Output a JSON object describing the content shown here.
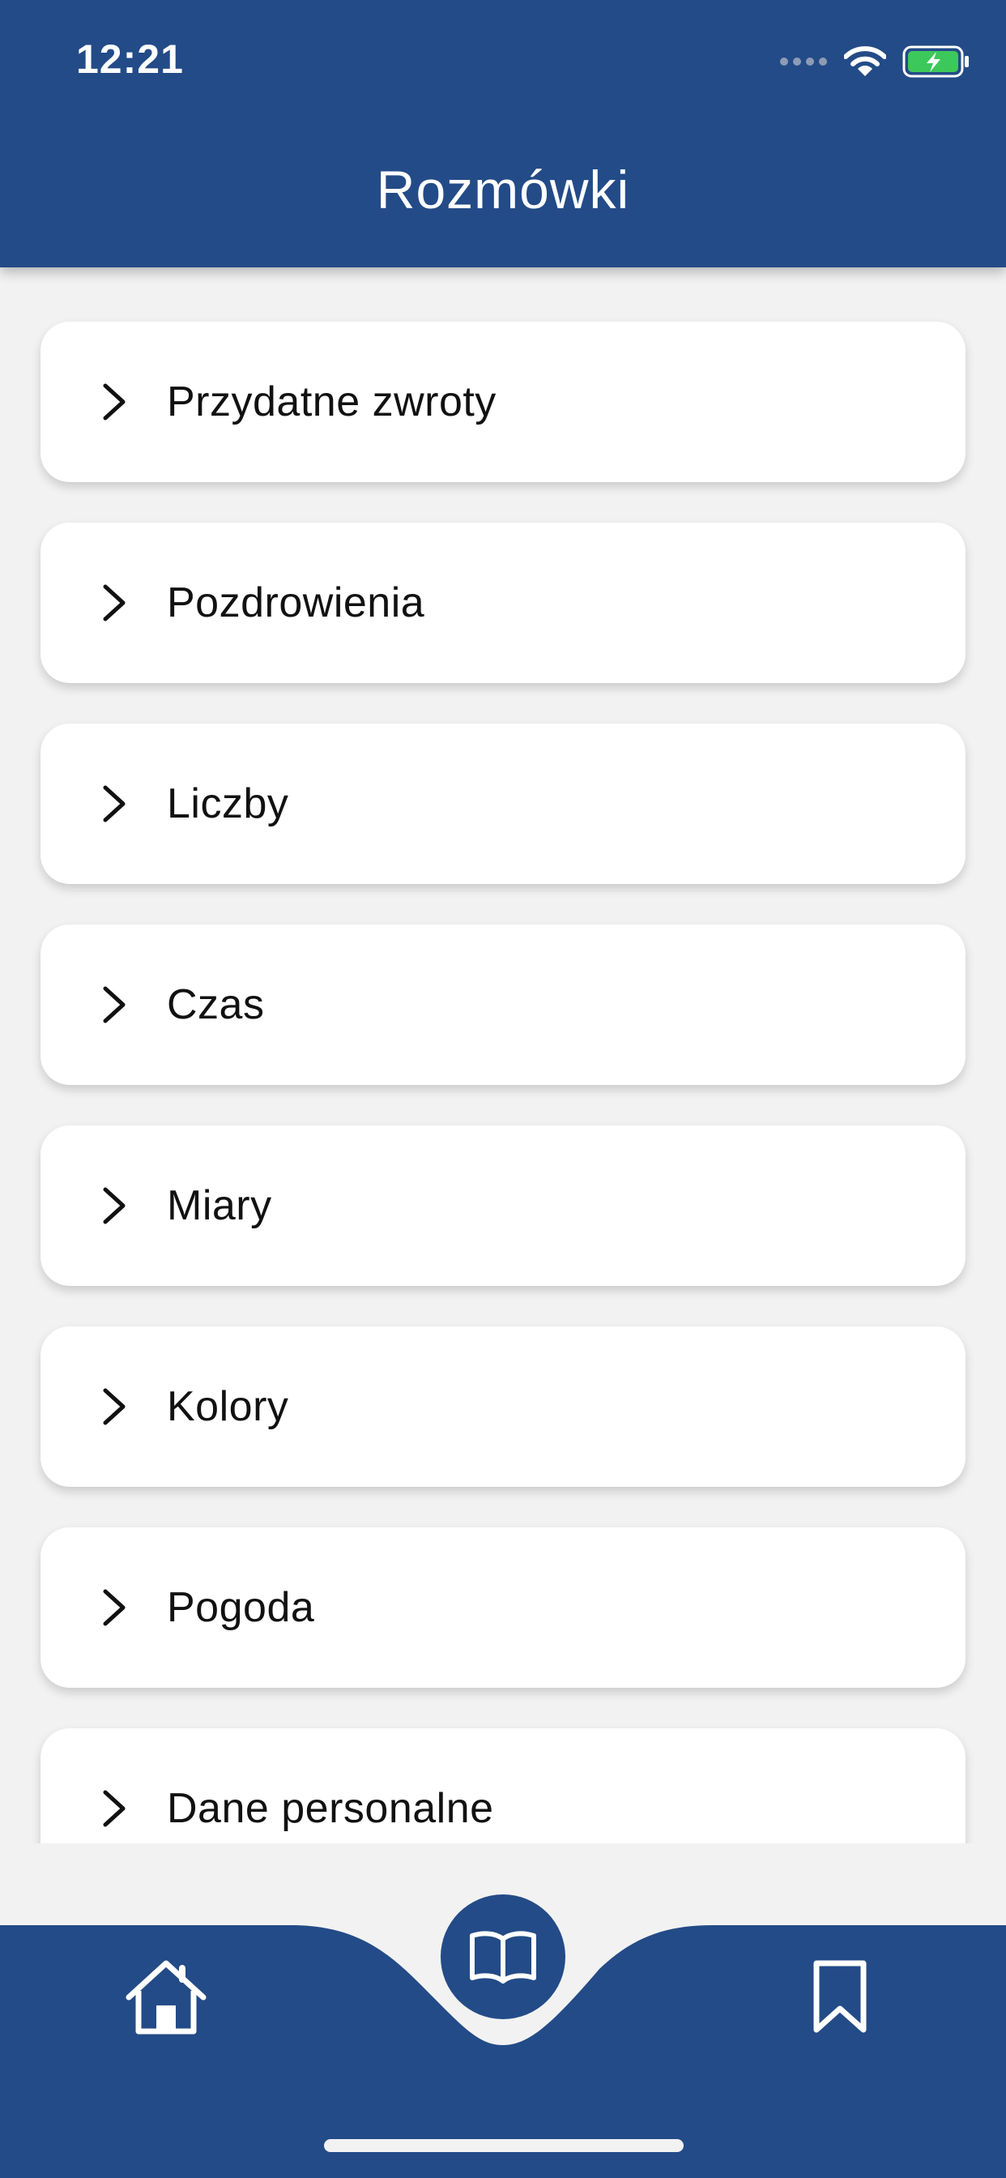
{
  "status_bar": {
    "time": "12:21",
    "icons": [
      "cellular-signal-icon",
      "wifi-icon",
      "battery-charging-icon"
    ]
  },
  "header": {
    "title": "Rozmówki"
  },
  "categories": [
    {
      "label": "Przydatne zwroty"
    },
    {
      "label": "Pozdrowienia"
    },
    {
      "label": "Liczby"
    },
    {
      "label": "Czas"
    },
    {
      "label": "Miary"
    },
    {
      "label": "Kolory"
    },
    {
      "label": "Pogoda"
    },
    {
      "label": "Dane personalne"
    }
  ],
  "bottom_nav": {
    "items": [
      {
        "icon": "home-icon"
      },
      {
        "icon": "open-book-icon",
        "active": true
      },
      {
        "icon": "bookmark-icon"
      }
    ]
  },
  "theme": {
    "primary": "#234b87",
    "background": "#f2f2f2",
    "card": "#ffffff",
    "battery": "#3cc85a"
  }
}
